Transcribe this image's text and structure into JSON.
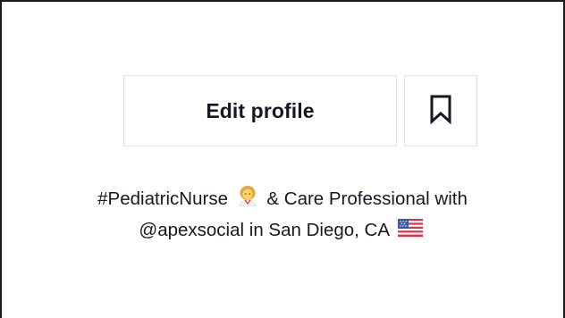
{
  "profile": {
    "edit_profile_label": "Edit profile",
    "bookmark_icon": "bookmark-icon"
  },
  "bio": {
    "line1_prefix": "#PediatricNurse",
    "line1_emoji": "woman-health-worker-emoji",
    "line1_suffix": "& Care Professional with",
    "line2_text": "@apexsocial in San Diego, CA",
    "line2_emoji": "us-flag-emoji"
  }
}
